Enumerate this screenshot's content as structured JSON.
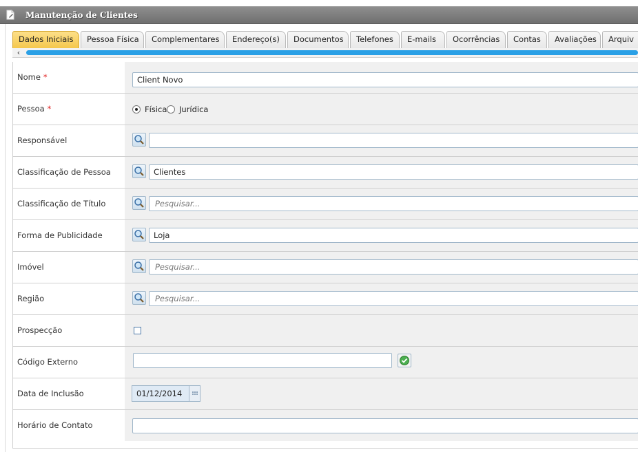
{
  "window": {
    "title": "Manutenção de Clientes",
    "icon": "document-edit-icon"
  },
  "tabs": [
    {
      "label": "Dados Iniciais",
      "active": true
    },
    {
      "label": "Pessoa Física",
      "active": false
    },
    {
      "label": "Complementares",
      "active": false
    },
    {
      "label": "Endereço(s)",
      "active": false
    },
    {
      "label": "Documentos",
      "active": false
    },
    {
      "label": "Telefones",
      "active": false
    },
    {
      "label": "E-mails",
      "active": false
    },
    {
      "label": "Ocorrências",
      "active": false
    },
    {
      "label": "Contas",
      "active": false
    },
    {
      "label": "Avaliações",
      "active": false
    },
    {
      "label": "Arquiv",
      "active": false
    }
  ],
  "tabs_scroll": {
    "left_arrow": "‹"
  },
  "form": {
    "required_marker": "*",
    "nome": {
      "label": "Nome",
      "value": "Client Novo"
    },
    "pessoa": {
      "label": "Pessoa",
      "option1": "Física",
      "option2": "Jurídica",
      "selected": "Física"
    },
    "responsavel": {
      "label": "Responsável",
      "value": ""
    },
    "classificacao_pessoa": {
      "label": "Classificação de Pessoa",
      "value": "Clientes"
    },
    "classificacao_titulo": {
      "label": "Classificação de Título",
      "placeholder": "Pesquisar..."
    },
    "forma_publicidade": {
      "label": "Forma de Publicidade",
      "value": "Loja"
    },
    "imovel": {
      "label": "Imóvel",
      "placeholder": "Pesquisar..."
    },
    "regiao": {
      "label": "Região",
      "placeholder": "Pesquisar..."
    },
    "prospeccao": {
      "label": "Prospecção",
      "checked": false
    },
    "codigo_externo": {
      "label": "Código Externo",
      "value": ""
    },
    "data_inclusao": {
      "label": "Data de Inclusão",
      "value": "01/12/2014"
    },
    "horario_contato": {
      "label": "Horário de Contato",
      "value": ""
    }
  },
  "colors": {
    "accent_tab": "#f5c84c",
    "scroll_thumb": "#2aa0e6",
    "required": "#e02020"
  }
}
